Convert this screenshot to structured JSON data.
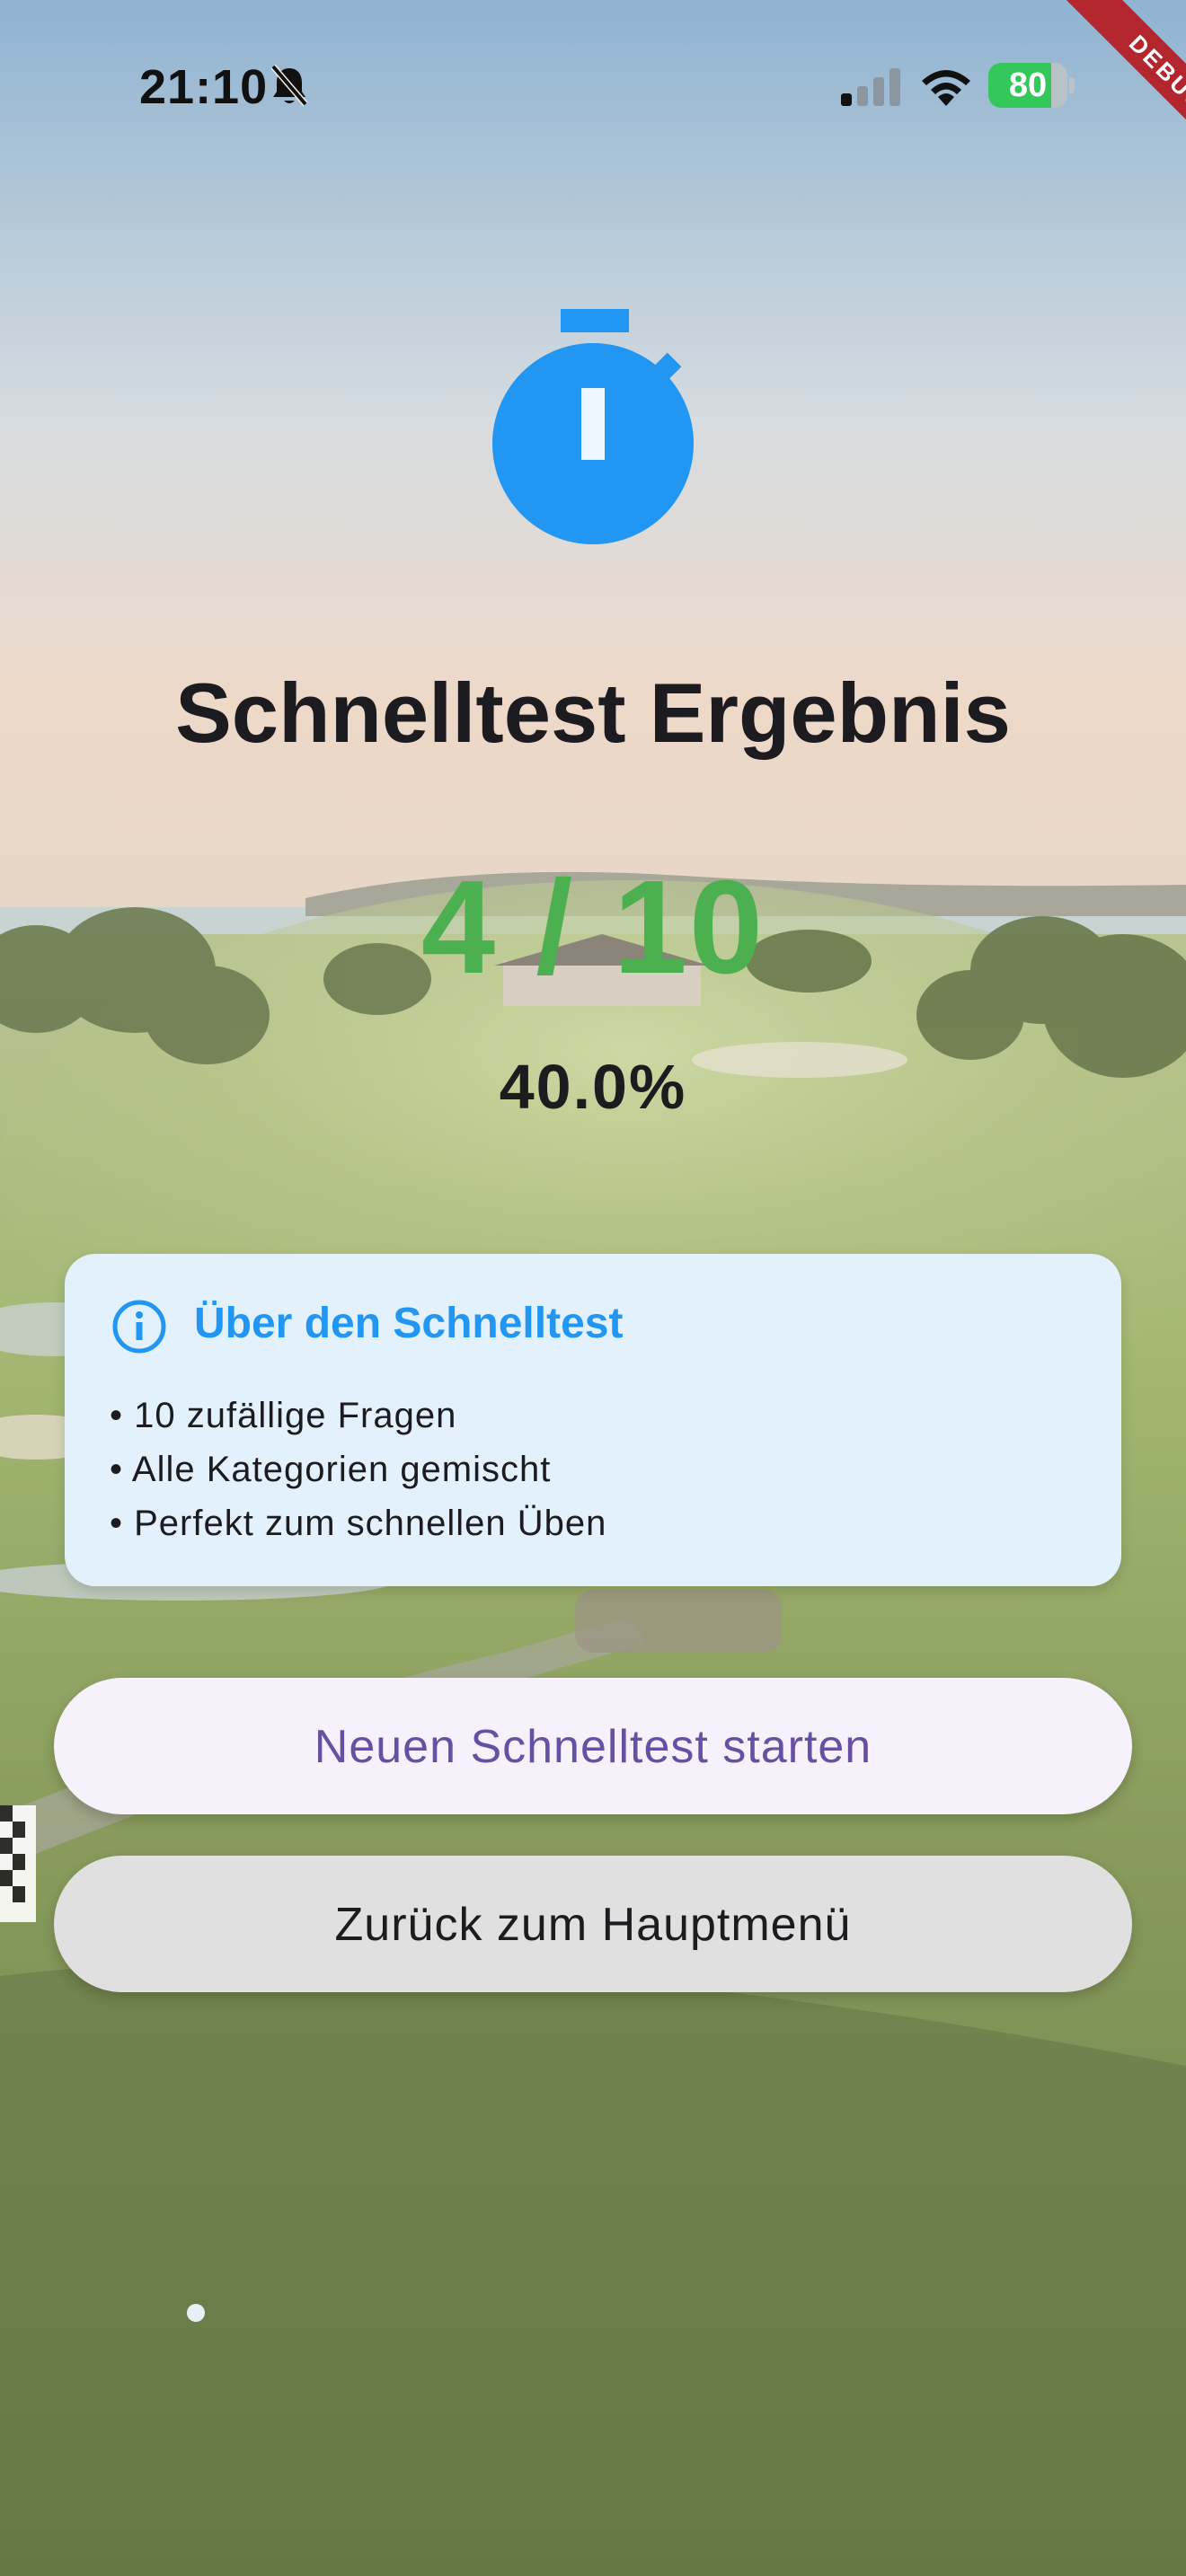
{
  "status_bar": {
    "time": "21:10",
    "battery_percent": 80,
    "battery_label": "80",
    "icons": [
      "bell-slash-icon",
      "cellular-signal-icon",
      "wifi-icon",
      "battery-charging-icon"
    ]
  },
  "debug_banner": {
    "label": "DEBUG"
  },
  "result": {
    "icon": "stopwatch-icon",
    "title": "Schnelltest Ergebnis",
    "score": "4 / 10",
    "percent": "40.0%"
  },
  "info_card": {
    "icon": "info-circle-icon",
    "title": "Über den Schnelltest",
    "items": [
      "• 10 zufällige Fragen",
      "• Alle Kategorien gemischt",
      "• Perfekt zum schnellen Üben"
    ]
  },
  "buttons": {
    "start_new": "Neuen Schnelltest starten",
    "back_to_menu": "Zurück zum Hauptmenü"
  },
  "colors": {
    "accent_blue": "#2196f3",
    "score_green": "#4caf50",
    "primary_button_text": "#6750a4",
    "info_card_bg": "#e3f1fc",
    "debug_red": "#b3262d"
  }
}
